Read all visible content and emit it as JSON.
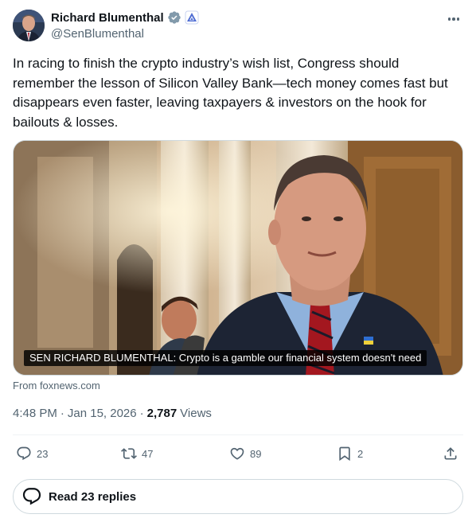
{
  "author": {
    "display_name": "Richard Blumenthal",
    "handle": "@SenBlumenthal",
    "verified_icon": "verified-badge-icon",
    "affiliate_icon": "us-government-affiliate-icon"
  },
  "tweet": {
    "text": "In racing to finish the crypto industry’s wish list, Congress should remember the lesson of Silicon Valley Bank—tech money comes fast but disappears even faster, leaving taxpayers & investors on the hook for bailouts & losses."
  },
  "media": {
    "caption": "SEN RICHARD BLUMENTHAL: Crypto is a gamble our financial system doesn't need",
    "source": "From foxnews.com"
  },
  "meta": {
    "time": "4:48 PM",
    "date": "Jan 15, 2026",
    "separator": "·",
    "views_count": "2,787",
    "views_label": "Views"
  },
  "actions": {
    "replies": "23",
    "reposts": "47",
    "likes": "89",
    "bookmarks": "2"
  },
  "read_replies_label": "Read 23 replies",
  "colors": {
    "text": "#0f1419",
    "secondary": "#536471",
    "verified_blue": "#1d9bf0",
    "border": "#cfd9de"
  }
}
